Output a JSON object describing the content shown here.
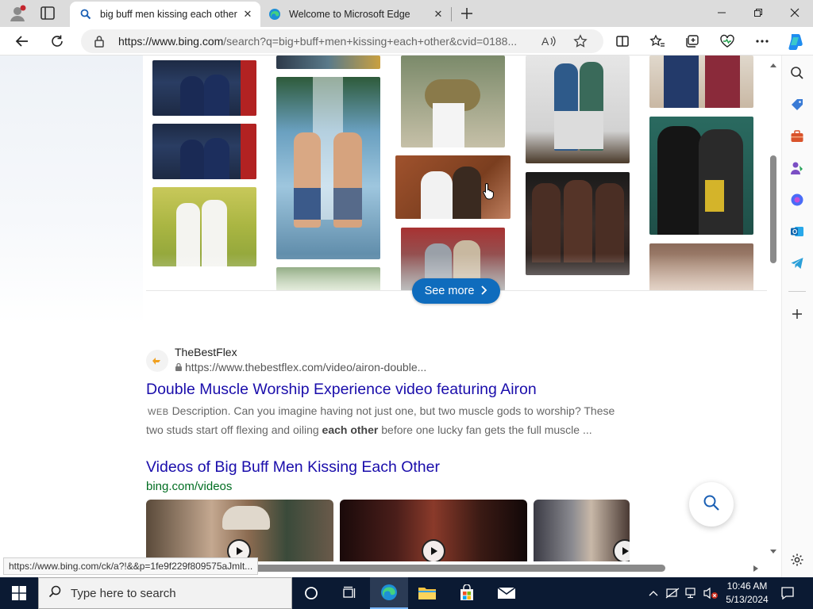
{
  "tabs": [
    {
      "title": "big buff men kissing each other",
      "icon": "search-icon"
    },
    {
      "title": "Welcome to Microsoft Edge",
      "icon": "edge-logo-icon"
    }
  ],
  "address": {
    "url_host": "https://www.bing.com",
    "url_rest": "/search?q=big+buff+men+kissing+each+other&cvid=0188..."
  },
  "images": {
    "see_more_label": "See more"
  },
  "result": {
    "site_name": "TheBestFlex",
    "site_url": "https://www.thebestflex.com/video/airon-double...",
    "title": "Double Muscle Worship Experience video featuring Airon",
    "badge": "WEB",
    "snippet_pre": "Description. Can you imagine having not just one, but two muscle gods to worship? These two studs start off flexing and oiling ",
    "snippet_bold": "each other",
    "snippet_post": " before one lucky fan gets the full muscle ..."
  },
  "videos": {
    "title": "Videos of Big Buff Men Kissing Each Other",
    "source": "bing.com/videos"
  },
  "status_url": "https://www.bing.com/ck/a?!&&p=1fe9f229f809575aJmlt...",
  "taskbar": {
    "search_placeholder": "Type here to search",
    "time": "10:46 AM",
    "date": "5/13/2024"
  },
  "colors": {
    "link": "#1a0dab",
    "cite": "#006d21",
    "accent": "#0f6cbd",
    "taskbar": "#0b1a33"
  }
}
